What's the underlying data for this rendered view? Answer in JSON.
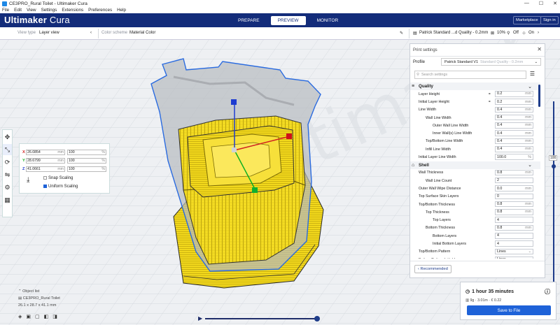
{
  "window": {
    "title": "CE3PRO_Rural Toilet - Ultimaker Cura",
    "controls": [
      "—",
      "☐",
      "✕"
    ]
  },
  "menubar": [
    "File",
    "Edit",
    "View",
    "Settings",
    "Extensions",
    "Preferences",
    "Help"
  ],
  "appbar": {
    "brand_bold": "Ultimaker",
    "brand_thin": " Cura",
    "stages": [
      "PREPARE",
      "PREVIEW",
      "MONITOR"
    ],
    "active_stage": "PREVIEW",
    "marketplace": "Marketplace",
    "signin": "Sign in"
  },
  "toolbar": {
    "view_type_label": "View type",
    "view_type_value": "Layer view",
    "color_scheme_label": "Color scheme",
    "color_scheme_value": "Material Color",
    "profile_summary": "Patrick Standard ...d Quality - 0.2mm",
    "infill": "10%",
    "support": "Off",
    "adhesion": "On"
  },
  "scale_panel": {
    "rows": [
      {
        "axis": "X",
        "mm": "26.0854",
        "unit": "mm",
        "pct": "100",
        "pct_unit": "%"
      },
      {
        "axis": "Y",
        "mm": "28.6799",
        "unit": "mm",
        "pct": "100",
        "pct_unit": "%"
      },
      {
        "axis": "Z",
        "mm": "41.0661",
        "unit": "mm",
        "pct": "100",
        "pct_unit": "%"
      }
    ],
    "snap_scaling": "Snap Scaling",
    "uniform_scaling": "Uniform Scaling"
  },
  "object_info": {
    "list_label": "Object list",
    "name": "CE3PRO_Rural Toilet",
    "dims": "26.1 x 28.7 x 41.1 mm"
  },
  "layer_slider_value": "100",
  "print_settings": {
    "title": "Print settings",
    "profile_label": "Profile",
    "profile_value": "Patrick Standard V1",
    "profile_sub": "Standard Quality - 0.2mm",
    "search_placeholder": "Search settings",
    "categories": [
      {
        "name": "Quality",
        "icon": "≡",
        "settings": [
          {
            "label": "Layer Height",
            "value": "0.2",
            "unit": "mm",
            "indent": 0,
            "link": true
          },
          {
            "label": "Initial Layer Height",
            "value": "0.2",
            "unit": "mm",
            "indent": 0,
            "link": true
          },
          {
            "label": "Line Width",
            "value": "0.4",
            "unit": "mm",
            "indent": 0
          },
          {
            "label": "Wall Line Width",
            "value": "0.4",
            "unit": "mm",
            "indent": 1
          },
          {
            "label": "Outer Wall Line Width",
            "value": "0.4",
            "unit": "mm",
            "indent": 2
          },
          {
            "label": "Inner Wall(s) Line Width",
            "value": "0.4",
            "unit": "mm",
            "indent": 2
          },
          {
            "label": "Top/Bottom Line Width",
            "value": "0.4",
            "unit": "mm",
            "indent": 1
          },
          {
            "label": "Infill Line Width",
            "value": "0.4",
            "unit": "mm",
            "indent": 1
          },
          {
            "label": "Initial Layer Line Width",
            "value": "100.0",
            "unit": "%",
            "indent": 0
          }
        ]
      },
      {
        "name": "Shell",
        "icon": "⌂",
        "settings": [
          {
            "label": "Wall Thickness",
            "value": "0.8",
            "unit": "mm",
            "indent": 0
          },
          {
            "label": "Wall Line Count",
            "value": "2",
            "unit": "",
            "indent": 1
          },
          {
            "label": "Outer Wall Wipe Distance",
            "value": "0.0",
            "unit": "mm",
            "indent": 0
          },
          {
            "label": "Top Surface Skin Layers",
            "value": "0",
            "unit": "",
            "indent": 0
          },
          {
            "label": "Top/Bottom Thickness",
            "value": "0.8",
            "unit": "mm",
            "indent": 0
          },
          {
            "label": "Top Thickness",
            "value": "0.8",
            "unit": "mm",
            "indent": 1
          },
          {
            "label": "Top Layers",
            "value": "4",
            "unit": "",
            "indent": 2
          },
          {
            "label": "Bottom Thickness",
            "value": "0.8",
            "unit": "mm",
            "indent": 1
          },
          {
            "label": "Bottom Layers",
            "value": "4",
            "unit": "",
            "indent": 2
          },
          {
            "label": "Initial Bottom Layers",
            "value": "4",
            "unit": "",
            "indent": 2
          },
          {
            "label": "Top/Bottom Pattern",
            "value": "Lines",
            "unit": "⌄",
            "indent": 0
          },
          {
            "label": "Bottom Pattern Initial Layer",
            "value": "Lines",
            "unit": "⌄",
            "indent": 0
          }
        ]
      }
    ],
    "recommended": "Recommended"
  },
  "job": {
    "time": "1 hour 35 minutes",
    "material": "9g · 3.01m · € 0.22",
    "save_button": "Save to File"
  }
}
